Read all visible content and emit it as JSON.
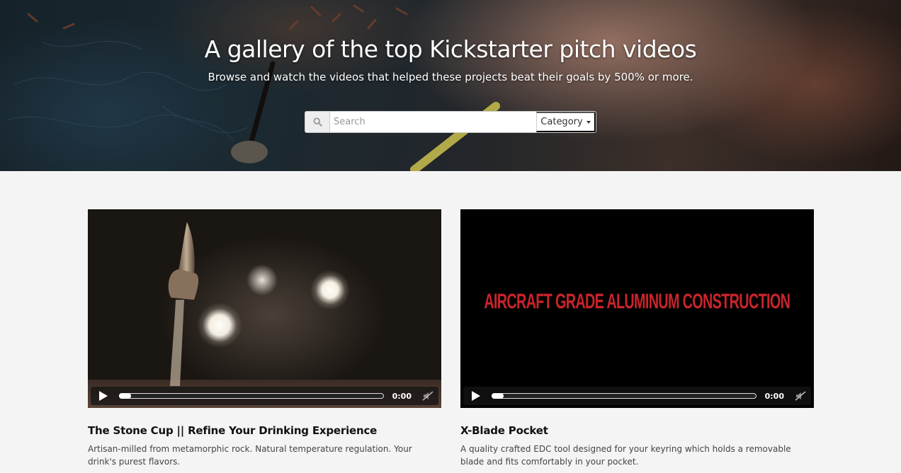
{
  "hero": {
    "title": "A gallery of the top Kickstarter pitch videos",
    "subtitle": "Browse and watch the videos that helped these projects beat their goals by 500% or more."
  },
  "search": {
    "placeholder": "Search",
    "value": "",
    "icon": "search-icon",
    "category_label": "Category"
  },
  "videos": [
    {
      "title": "The Stone Cup || Refine Your Drinking Experience",
      "description": "Artisan-milled from metamorphic rock. Natural temperature regulation. Your drink's purest flavors.",
      "overlay_text": "",
      "time": "0:00",
      "progress": 0
    },
    {
      "title": "X-Blade Pocket",
      "description": "A quality crafted EDC tool designed for your keyring which holds a removable blade and fits comfortably in your pocket.",
      "overlay_text": "AIRCRAFT GRADE ALUMINUM CONSTRUCTION",
      "time": "0:00",
      "progress": 0
    }
  ],
  "colors": {
    "page_background": "#f4f4f4",
    "overlay_text": "#c9242b"
  }
}
